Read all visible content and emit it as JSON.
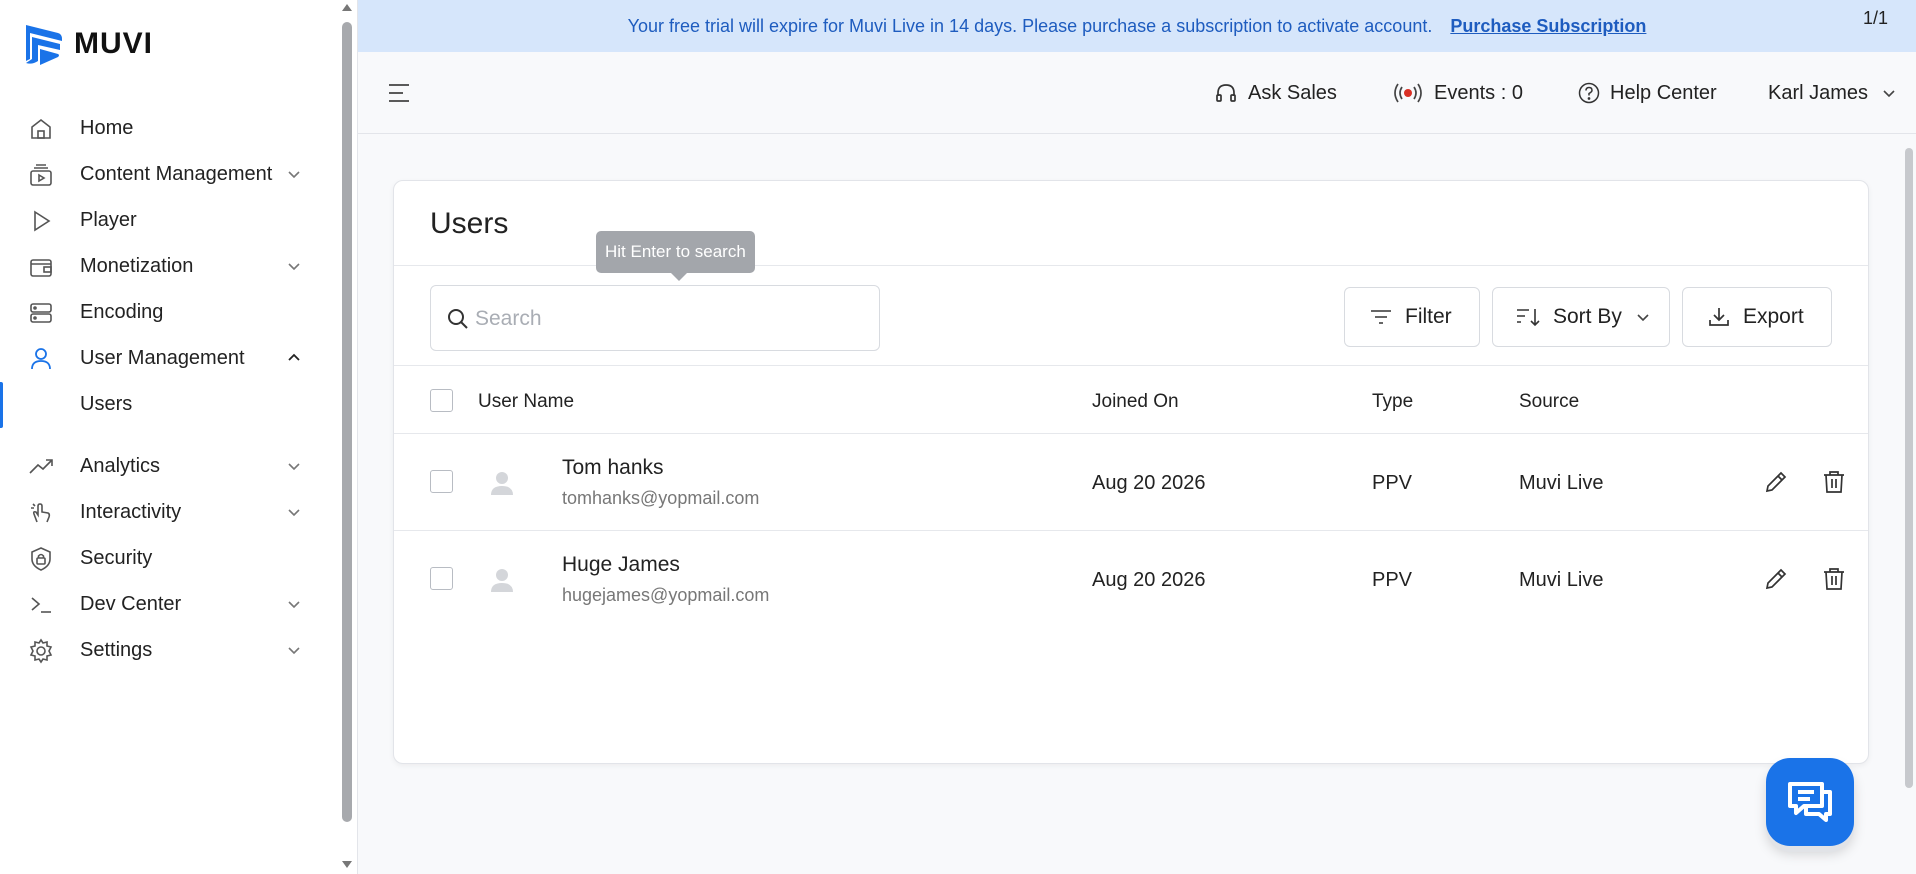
{
  "brand": {
    "name": "MUVI",
    "accent": "#1a73e8"
  },
  "sidebar": {
    "items": [
      {
        "label": "Home",
        "icon": "home-icon"
      },
      {
        "label": "Content Management",
        "icon": "content-icon",
        "expandable": true
      },
      {
        "label": "Player",
        "icon": "play-icon"
      },
      {
        "label": "Monetization",
        "icon": "wallet-icon",
        "expandable": true
      },
      {
        "label": "Encoding",
        "icon": "server-icon"
      },
      {
        "label": "User Management",
        "icon": "user-icon",
        "expanded": true
      },
      {
        "label": "Analytics",
        "icon": "trend-icon",
        "expandable": true
      },
      {
        "label": "Interactivity",
        "icon": "hand-icon",
        "expandable": true
      },
      {
        "label": "Security",
        "icon": "shield-icon"
      },
      {
        "label": "Dev Center",
        "icon": "terminal-icon",
        "expandable": true
      },
      {
        "label": "Settings",
        "icon": "gear-icon",
        "expandable": true
      }
    ],
    "sub_items": [
      {
        "label": "Users",
        "active": true
      }
    ]
  },
  "banner": {
    "text": "Your free trial will expire for Muvi Live in 14 days. Please purchase a subscription to activate account.",
    "link": "Purchase Subscription",
    "counter": "1/1"
  },
  "topbar": {
    "ask_sales": "Ask Sales",
    "events": "Events : 0",
    "help": "Help Center",
    "user": "Karl James"
  },
  "page": {
    "title": "Users",
    "search_placeholder": "Search",
    "search_tooltip": "Hit Enter to search",
    "filter": "Filter",
    "sort": "Sort By",
    "export": "Export"
  },
  "table": {
    "headers": [
      "User Name",
      "Joined On",
      "Type",
      "Source"
    ],
    "rows": [
      {
        "name": "Tom hanks",
        "email": "tomhanks@yopmail.com",
        "joined": "Aug 20 2026",
        "type": "PPV",
        "source": "Muvi Live"
      },
      {
        "name": "Huge James",
        "email": "hugejames@yopmail.com",
        "joined": "Aug 20 2026",
        "type": "PPV",
        "source": "Muvi Live"
      }
    ]
  }
}
